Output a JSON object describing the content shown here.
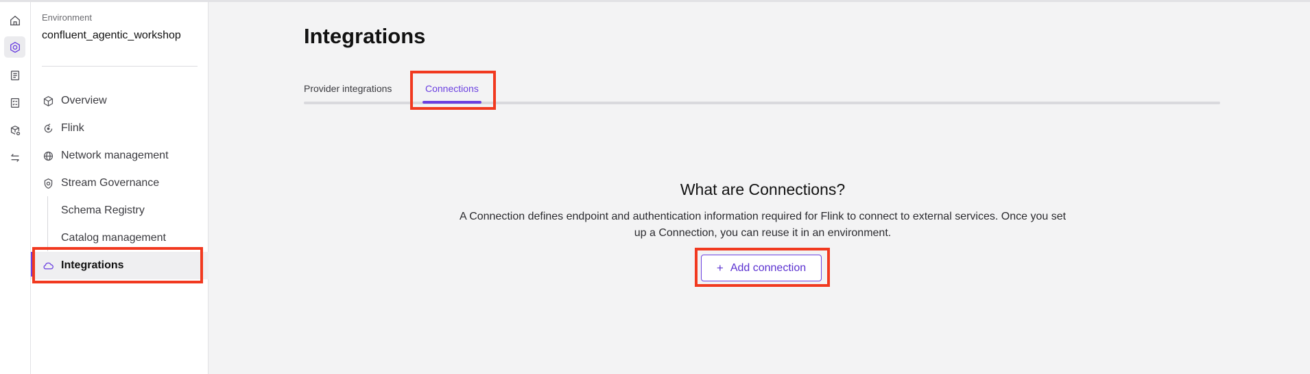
{
  "rail": {
    "items": [
      "home-icon",
      "environment-icon",
      "document-icon",
      "checklist-icon",
      "cube-cluster-icon",
      "swap-arrows-icon"
    ]
  },
  "sidebar": {
    "env_label": "Environment",
    "env_name": "confluent_agentic_workshop",
    "items": [
      {
        "label": "Overview",
        "icon": "cube-icon"
      },
      {
        "label": "Flink",
        "icon": "flink-icon"
      },
      {
        "label": "Network management",
        "icon": "globe-icon"
      },
      {
        "label": "Stream Governance",
        "icon": "shield-icon"
      },
      {
        "label": "Schema Registry"
      },
      {
        "label": "Catalog management"
      },
      {
        "label": "Integrations",
        "icon": "cloud-icon",
        "selected": true
      }
    ]
  },
  "main": {
    "title": "Integrations",
    "tabs": [
      {
        "label": "Provider integrations"
      },
      {
        "label": "Connections",
        "active": true
      }
    ],
    "empty_state": {
      "heading": "What are Connections?",
      "line1": "A Connection defines endpoint and authentication information required for Flink to connect to external services. Once you set",
      "line2": "up a Connection, you can reuse it in an environment.",
      "button_label": "Add connection"
    }
  },
  "colors": {
    "accent": "#6a3fe0",
    "highlight": "#f1391f"
  }
}
